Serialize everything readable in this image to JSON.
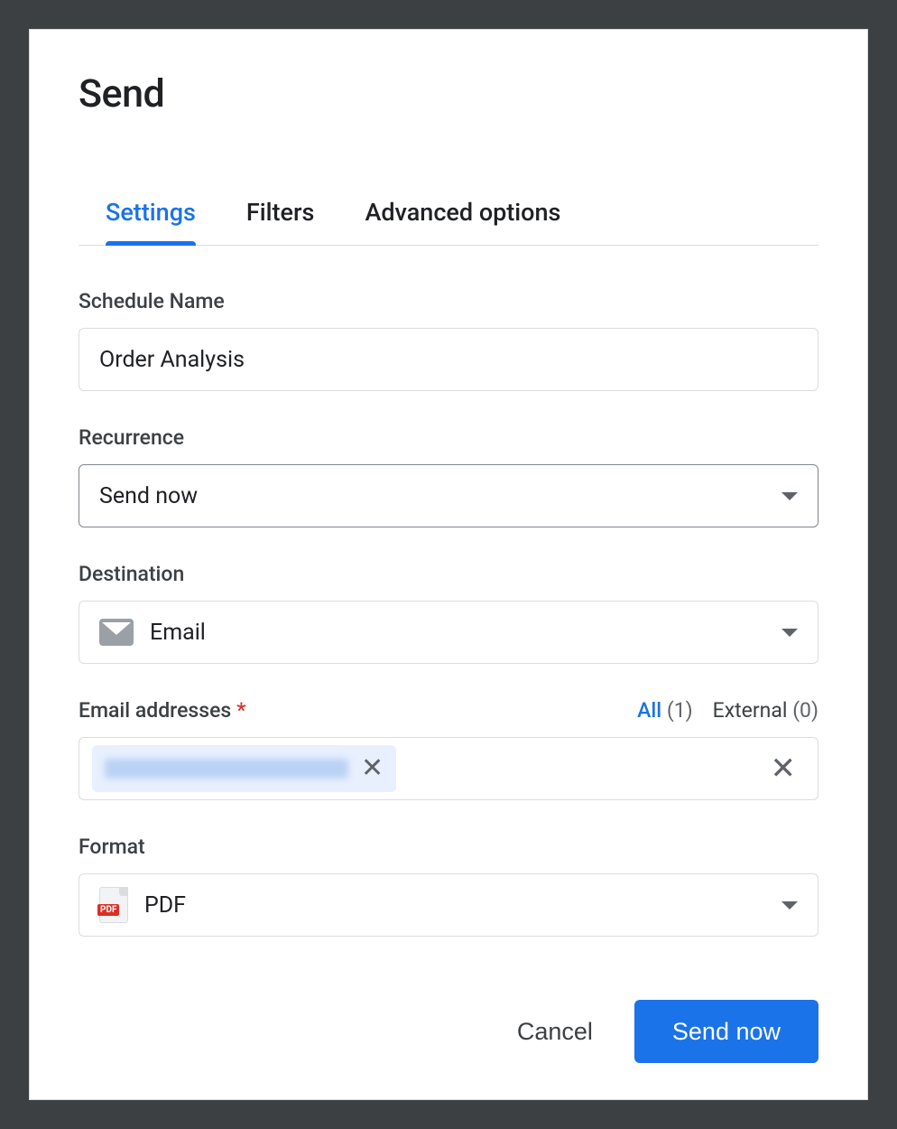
{
  "dialog": {
    "title": "Send",
    "tabs": [
      {
        "label": "Settings",
        "active": true
      },
      {
        "label": "Filters",
        "active": false
      },
      {
        "label": "Advanced options",
        "active": false
      }
    ],
    "schedule_name": {
      "label": "Schedule Name",
      "value": "Order Analysis"
    },
    "recurrence": {
      "label": "Recurrence",
      "value": "Send now"
    },
    "destination": {
      "label": "Destination",
      "value": "Email",
      "icon": "mail-icon"
    },
    "email": {
      "label": "Email addresses",
      "required_mark": "*",
      "counts": {
        "all_label": "All",
        "all_count": "(1)",
        "external_label": "External",
        "external_count": "(0)"
      },
      "chips": [
        {
          "redacted": true
        }
      ]
    },
    "format": {
      "label": "Format",
      "value": "PDF",
      "icon": "pdf-icon"
    },
    "footer": {
      "cancel": "Cancel",
      "primary": "Send now"
    }
  }
}
